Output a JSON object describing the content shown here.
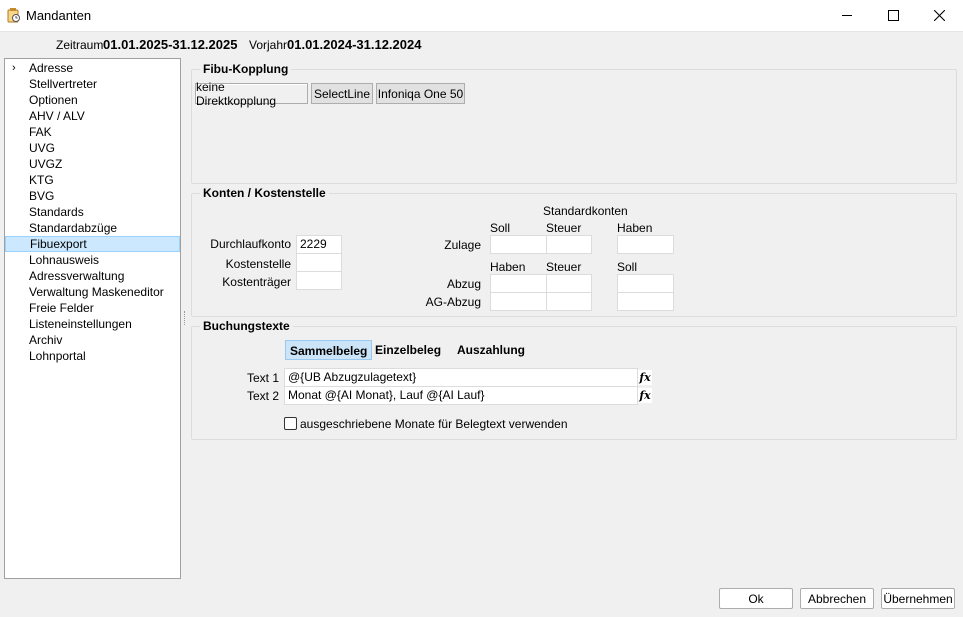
{
  "window": {
    "title": "Mandanten",
    "icon": "app-icon"
  },
  "period": {
    "zeitraum_label": "Zeitraum",
    "zeitraum_value": "01.01.2025-31.12.2025",
    "vorjahr_label": "Vorjahr",
    "vorjahr_value": "01.01.2024-31.12.2024"
  },
  "nav": {
    "items": [
      "Adresse",
      "Stellvertreter",
      "Optionen",
      "AHV / ALV",
      "FAK",
      "UVG",
      "UVGZ",
      "KTG",
      "BVG",
      "Standards",
      "Standardabzüge",
      "Fibuexport",
      "Lohnausweis",
      "Adressverwaltung",
      "Verwaltung Maskeneditor",
      "Freie Felder",
      "Listeneinstellungen",
      "Archiv",
      "Lohnportal"
    ],
    "selected": "Fibuexport"
  },
  "fibu": {
    "title": "Fibu-Kopplung",
    "buttons": [
      "keine Direktkopplung",
      "SelectLine",
      "Infoniqa One 50"
    ]
  },
  "konten": {
    "title": "Konten / Kostenstelle",
    "durchlaufkonto_label": "Durchlaufkonto",
    "durchlaufkonto_value": "2229",
    "kostenstelle_label": "Kostenstelle",
    "kostentraeger_label": "Kostenträger",
    "standardkonten_label": "Standardkonten",
    "zulage_label": "Zulage",
    "abzug_label": "Abzug",
    "ag_abzug_label": "AG-Abzug",
    "col_soll": "Soll",
    "col_steuer": "Steuer",
    "col_haben": "Haben",
    "col2_haben": "Haben",
    "col2_steuer": "Steuer",
    "col2_soll": "Soll"
  },
  "buchung": {
    "title": "Buchungstexte",
    "tabs": [
      "Sammelbeleg",
      "Einzelbeleg",
      "Auszahlung"
    ],
    "text1_label": "Text 1",
    "text1_value": "@{UB Abzugzulagetext}",
    "text2_label": "Text 2",
    "text2_value": "Monat @{AI Monat}, Lauf @{AI Lauf}",
    "checkbox_label": "ausgeschriebene Monate für Belegtext verwenden",
    "checkbox_checked": false
  },
  "footer": {
    "ok": "Ok",
    "abbrechen": "Abbrechen",
    "uebernehmen": "Übernehmen"
  }
}
